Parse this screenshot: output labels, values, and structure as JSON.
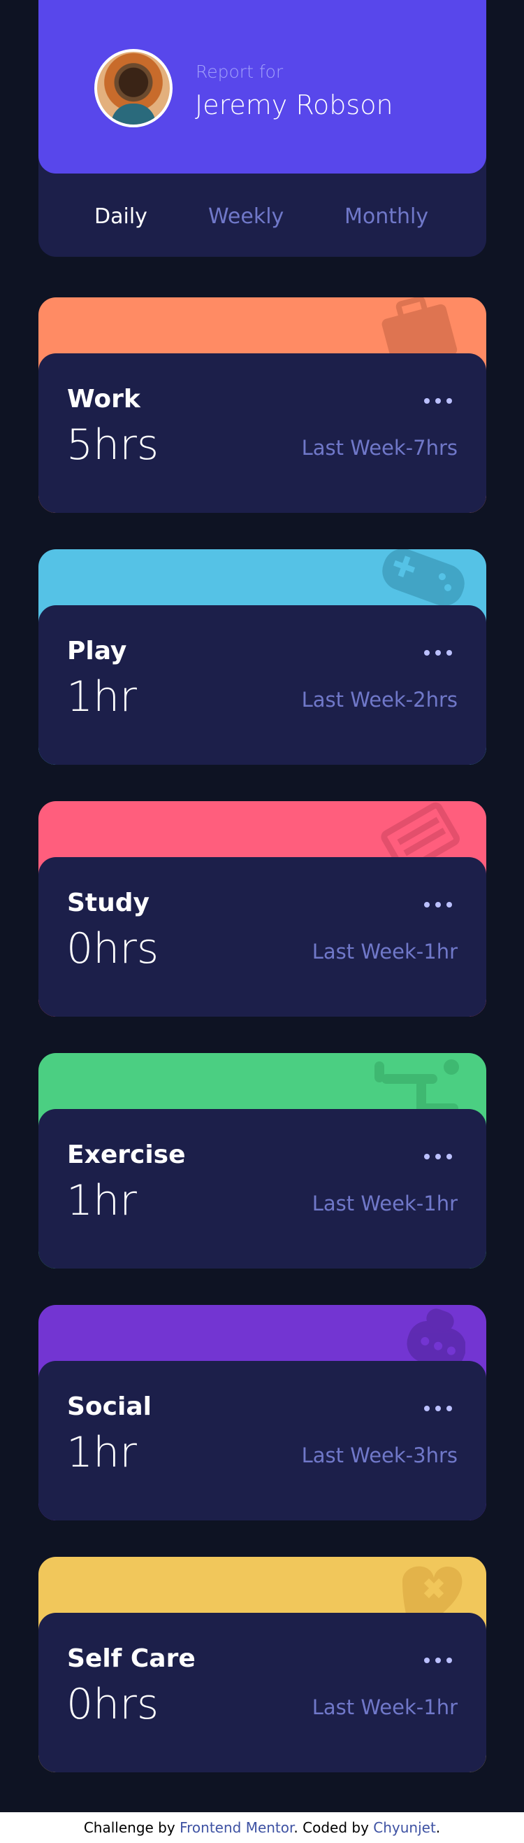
{
  "profile": {
    "report_for": "Report for",
    "name": "Jeremy Robson",
    "periods": [
      "Daily",
      "Weekly",
      "Monthly"
    ],
    "active_period": "Daily"
  },
  "colors": {
    "work": "#ff8b64",
    "play": "#55c2e6",
    "study": "#ff5e7d",
    "exercise": "#4bcf82",
    "social": "#7335d2",
    "self_care": "#f1c75b",
    "card": "#1c1f4a",
    "accent": "#5847eb"
  },
  "cards": [
    {
      "title": "Work",
      "hours": "5hrs",
      "last": "Last Week-7hrs",
      "icon": "briefcase-icon"
    },
    {
      "title": "Play",
      "hours": "1hr",
      "last": "Last Week-2hrs",
      "icon": "gamepad-icon"
    },
    {
      "title": "Study",
      "hours": "0hrs",
      "last": "Last Week-1hr",
      "icon": "books-icon"
    },
    {
      "title": "Exercise",
      "hours": "1hr",
      "last": "Last Week-1hr",
      "icon": "runner-icon"
    },
    {
      "title": "Social",
      "hours": "1hr",
      "last": "Last Week-3hrs",
      "icon": "chat-bubble-icon"
    },
    {
      "title": "Self Care",
      "hours": "0hrs",
      "last": "Last Week-1hr",
      "icon": "heart-icon"
    }
  ],
  "footer": {
    "prefix": "Challenge by ",
    "link1": "Frontend Mentor",
    "middle": ". Coded by ",
    "link2": "Chyunjet",
    "suffix": "."
  }
}
